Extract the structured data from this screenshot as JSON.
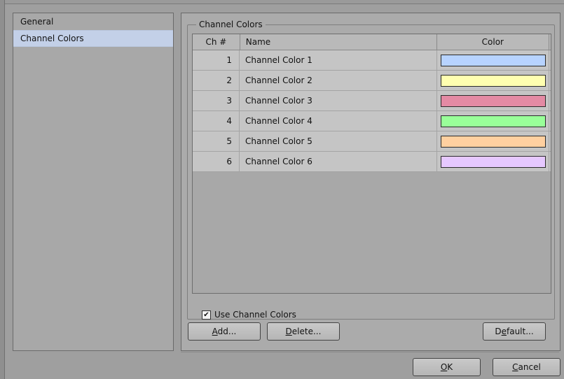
{
  "nav": {
    "items": [
      {
        "label": "General",
        "selected": false
      },
      {
        "label": "Channel Colors",
        "selected": true
      }
    ]
  },
  "group": {
    "title": "Channel Colors"
  },
  "grid": {
    "columns": [
      "Ch #",
      "Name",
      "Color"
    ],
    "rows": [
      {
        "num": "1",
        "name": "Channel Color 1",
        "color": "#b7d3ff"
      },
      {
        "num": "2",
        "name": "Channel Color 2",
        "color": "#ffffb0"
      },
      {
        "num": "3",
        "name": "Channel Color 3",
        "color": "#e48aa4"
      },
      {
        "num": "4",
        "name": "Channel Color 4",
        "color": "#99ff99"
      },
      {
        "num": "5",
        "name": "Channel Color 5",
        "color": "#ffd0a0"
      },
      {
        "num": "6",
        "name": "Channel Color 6",
        "color": "#e6c8ff"
      }
    ]
  },
  "use_colors": {
    "label": "Use Channel Colors",
    "checked": true,
    "check_glyph": "✔"
  },
  "buttons": {
    "add": {
      "underline": "A",
      "rest": "dd..."
    },
    "delete": {
      "underline": "D",
      "rest": "elete..."
    },
    "default": {
      "pre": "D",
      "underline": "e",
      "rest": "fault..."
    },
    "ok": {
      "underline": "O",
      "rest": "K"
    },
    "cancel": {
      "underline": "C",
      "rest": "ancel"
    }
  }
}
